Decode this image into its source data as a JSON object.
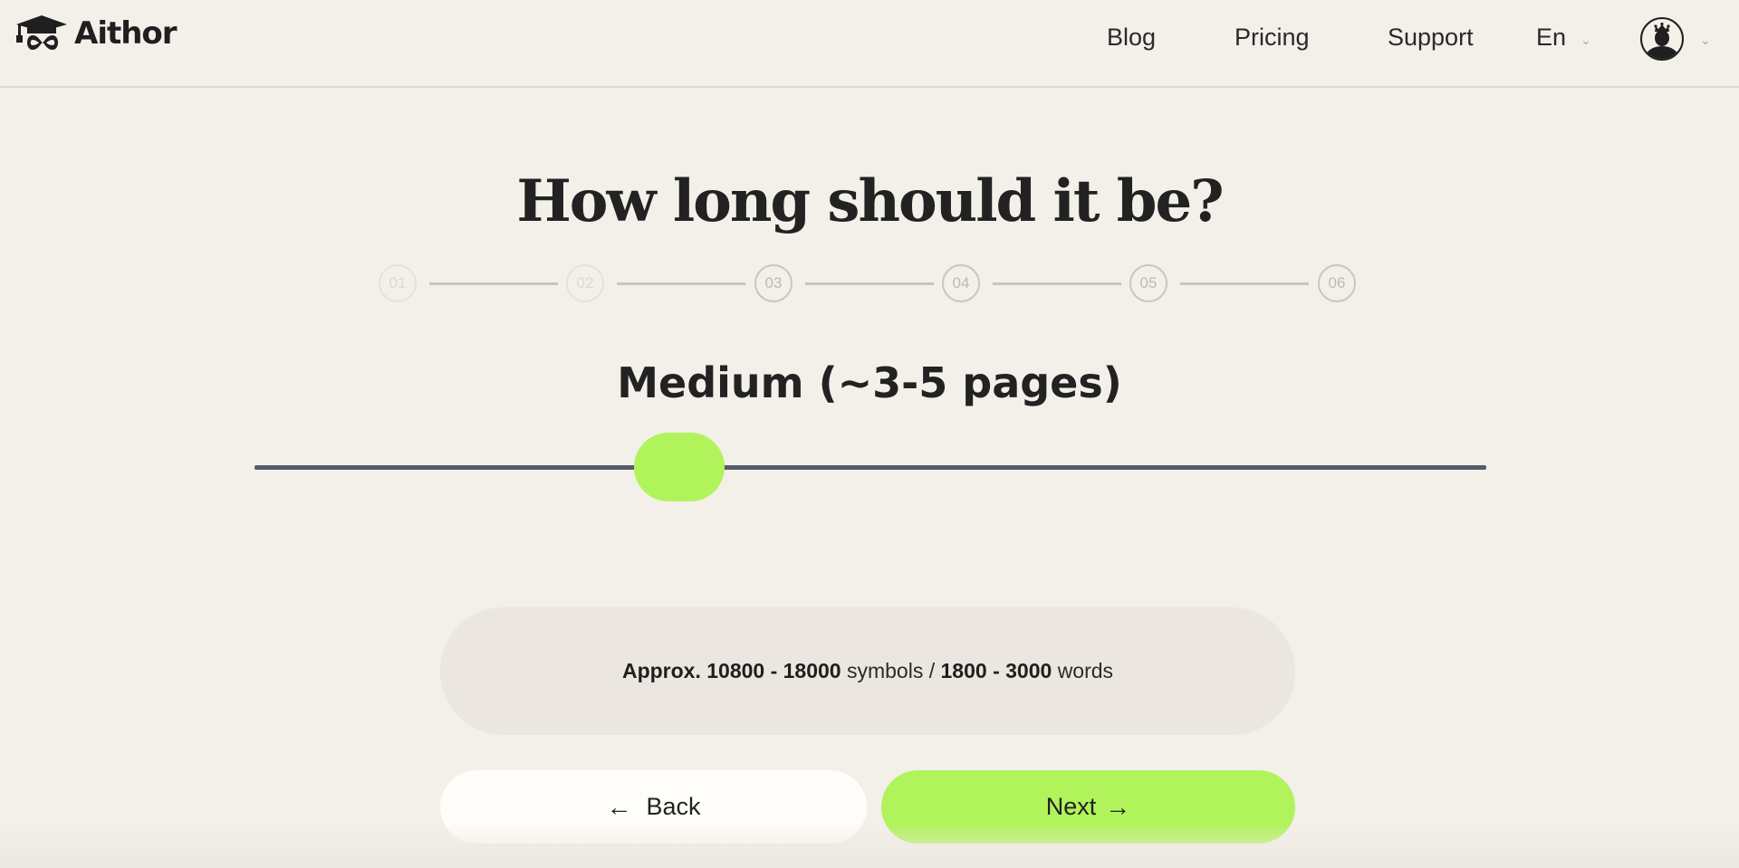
{
  "header": {
    "logo_text": "Aithor",
    "nav": [
      {
        "label": "Blog"
      },
      {
        "label": "Pricing"
      },
      {
        "label": "Support"
      }
    ],
    "language": {
      "selected": "En"
    },
    "user_menu": {
      "avatar_icon": "crowned-user-icon"
    }
  },
  "main": {
    "title": "How long should it be?",
    "steps": [
      {
        "label": "01",
        "state": "completed"
      },
      {
        "label": "02",
        "state": "completed"
      },
      {
        "label": "03",
        "state": "current"
      },
      {
        "label": "04",
        "state": "upcoming"
      },
      {
        "label": "05",
        "state": "upcoming"
      },
      {
        "label": "06",
        "state": "upcoming"
      }
    ],
    "length_label": "Medium (~3-5 pages)",
    "slider": {
      "value_fraction": 0.345
    },
    "info": {
      "prefix": "Approx.",
      "symbols_range": "10800 - 18000",
      "symbols_unit": "symbols /",
      "words_range": "1800 - 3000",
      "words_unit": "words"
    },
    "back_label": "Back",
    "next_label": "Next"
  },
  "colors": {
    "accent": "#b1f35b",
    "background": "#f3efe9",
    "track": "#575b69"
  }
}
